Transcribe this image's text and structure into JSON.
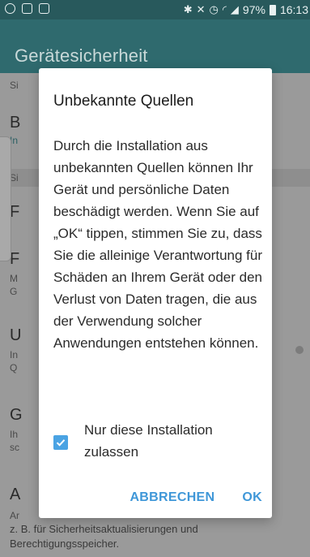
{
  "status_bar": {
    "left_icons": [
      "whatsapp-icon",
      "message-icon",
      "gallery-icon"
    ],
    "right_icons": [
      "bluetooth-icon",
      "mute-icon",
      "alarm-icon",
      "wifi-icon",
      "signal-icon",
      "battery-icon"
    ],
    "battery": "97%",
    "time": "16:13"
  },
  "app_bar": {
    "title": "Gerätesicherheit"
  },
  "background": {
    "fragments": [
      "Si",
      "B",
      "In",
      "Si",
      "F",
      "F",
      "M",
      "G",
      "U",
      "In",
      "Q",
      "G",
      "Ih",
      "sc",
      "A"
    ],
    "bottom_line1": "Ar",
    "bottom_line2": "z. B. für Sicherheitsaktualisierungen und",
    "bottom_line3": "Berechtigungsspeicher."
  },
  "dialog": {
    "title": "Unbekannte Quellen",
    "message": "Durch die Installation aus unbekannten Quellen können Ihr Gerät und persönliche Daten beschädigt werden. Wenn Sie auf „OK“ tippen, stimmen Sie zu, dass Sie die alleinige Verantwortung für Schäden an Ihrem Gerät oder den Verlust von Daten tragen, die aus der Verwendung solcher Anwendungen entstehen können.",
    "checkbox_label": "Nur diese Installation zulassen",
    "checkbox_checked": true,
    "cancel_label": "ABBRECHEN",
    "ok_label": "OK"
  },
  "colors": {
    "status_bar": "#28595c",
    "app_bar": "#2f6a6e",
    "accent": "#3f97d8",
    "checkbox": "#4aa3e3"
  }
}
